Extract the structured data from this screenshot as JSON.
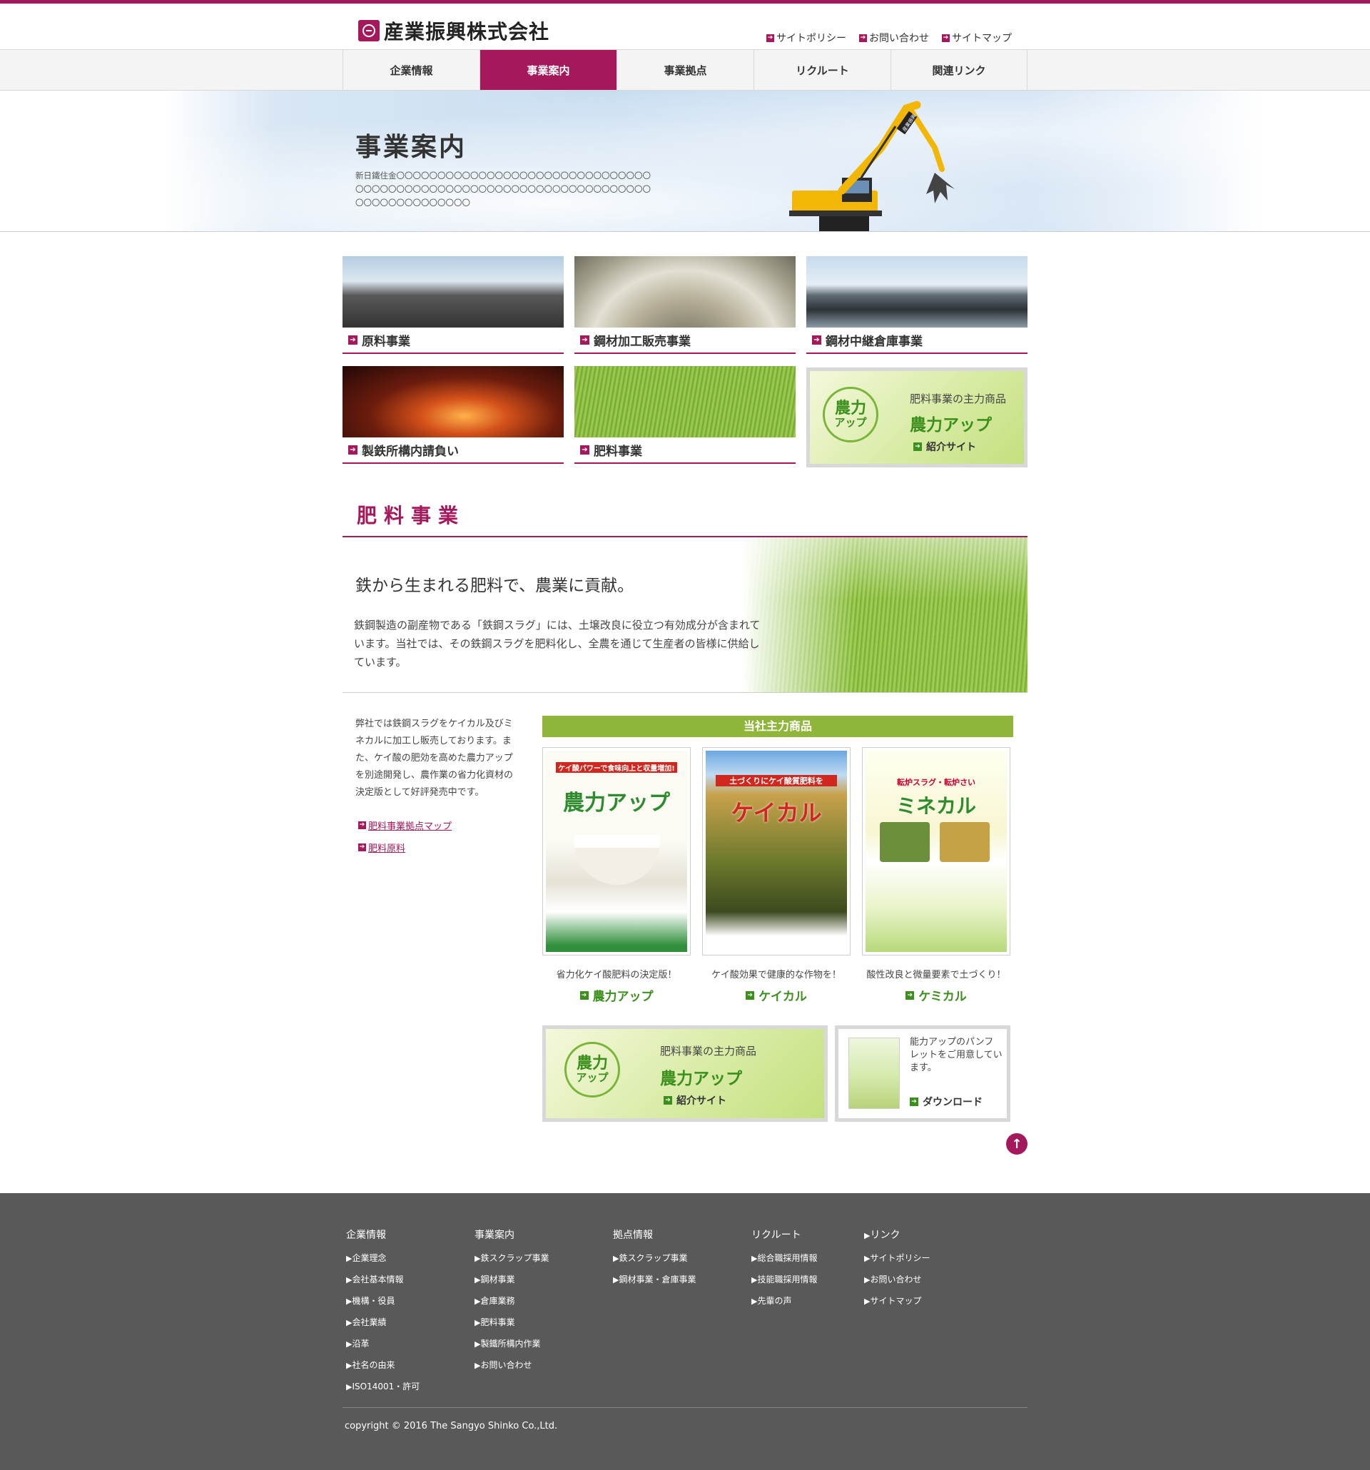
{
  "brand": {
    "name": "産業振興株式会社",
    "accent": "#a3195b"
  },
  "utility_links": [
    "サイトポリシー",
    "お問い合わせ",
    "サイトマップ"
  ],
  "nav": [
    {
      "label": "企業情報",
      "active": false
    },
    {
      "label": "事業案内",
      "active": true
    },
    {
      "label": "事業拠点",
      "active": false
    },
    {
      "label": "リクルート",
      "active": false
    },
    {
      "label": "関連リンク",
      "active": false
    }
  ],
  "hero": {
    "title": "事業案内",
    "desc": "新日鐵住金〇〇〇〇〇〇〇〇〇〇〇〇〇〇〇〇〇〇〇〇〇〇〇〇〇〇〇〇〇〇〇〇〇〇〇〇〇〇〇〇〇〇〇〇〇〇〇〇〇〇〇〇〇〇〇〇〇〇〇〇〇〇〇〇〇〇〇〇〇〇〇〇〇〇〇〇〇〇〇〇〇",
    "machine_sign": "産業振興"
  },
  "tiles": [
    {
      "label": "原料事業"
    },
    {
      "label": "鋼材加工販売事業"
    },
    {
      "label": "鋼材中継倉庫事業"
    },
    {
      "label": "製鉄所構内請負い"
    },
    {
      "label": "肥料事業"
    }
  ],
  "noryoku_banner": {
    "logo_line1": "農力",
    "logo_line2": "アップ",
    "sub": "肥料事業の主力商品",
    "main": "農力アップ",
    "link": "紹介サイト"
  },
  "section": {
    "title": "肥料事業",
    "headline": "鉄から生まれる肥料で、農業に貢献。",
    "body": "鉄鋼製造の副産物である「鉄鋼スラグ」には、土壌改良に役立つ有効成分が含まれています。当社では、その鉄鋼スラグを肥料化し、全農を通じて生産者の皆様に供給しています。"
  },
  "detail": {
    "text": "弊社では鉄鋼スラグをケイカル及びミネカルに加工し販売しております。また、ケイ酸の肥効を高めた農力アップを別途開発し、農作業の省力化資材の決定版として好評発売中です。",
    "links": [
      "肥料事業拠点マップ",
      "肥料原料"
    ]
  },
  "products": {
    "heading": "当社主力商品",
    "items": [
      {
        "caption": "省力化ケイ酸肥料の決定版！",
        "name": "農力アップ",
        "poster_title": "農力アップ",
        "poster_tag": "ケイ酸パワーで食味向上と収量増加!"
      },
      {
        "caption": "ケイ酸効果で健康的な作物を！",
        "name": "ケイカル",
        "poster_title": "ケイカル",
        "poster_tag": "土づくりにケイ酸質肥料を"
      },
      {
        "caption": "酸性改良と微量要素で土づくり！",
        "name": "ケミカル",
        "poster_title": "ミネカル",
        "poster_tag": "転炉スラグ・転炉さい"
      }
    ]
  },
  "pamphlet": {
    "text": "能力アップのパンフレットをご用意しています。",
    "link": "ダウンロード"
  },
  "footer": {
    "columns": [
      {
        "title": "企業情報",
        "items": [
          "企業理念",
          "会社基本情報",
          "機構・役員",
          "会社業績",
          "沿革",
          "社名の由来",
          "ISO14001・許可"
        ]
      },
      {
        "title": "事業案内",
        "items": [
          "鉄スクラップ事業",
          "鋼材事業",
          "倉庫業務",
          "肥料事業",
          "製鐵所構内作業",
          "お問い合わせ"
        ]
      },
      {
        "title": "拠点情報",
        "items": [
          "鉄スクラップ事業",
          "鋼材事業・倉庫事業"
        ]
      },
      {
        "title": "リクルート",
        "items": [
          "総合職採用情報",
          "技能職採用情報",
          "先輩の声"
        ]
      },
      {
        "title": "",
        "items": [
          "リンク",
          "サイトポリシー",
          "お問い合わせ",
          "サイトマップ"
        ]
      }
    ],
    "copyright": "copyright © 2016 The Sangyo Shinko Co.,Ltd."
  }
}
